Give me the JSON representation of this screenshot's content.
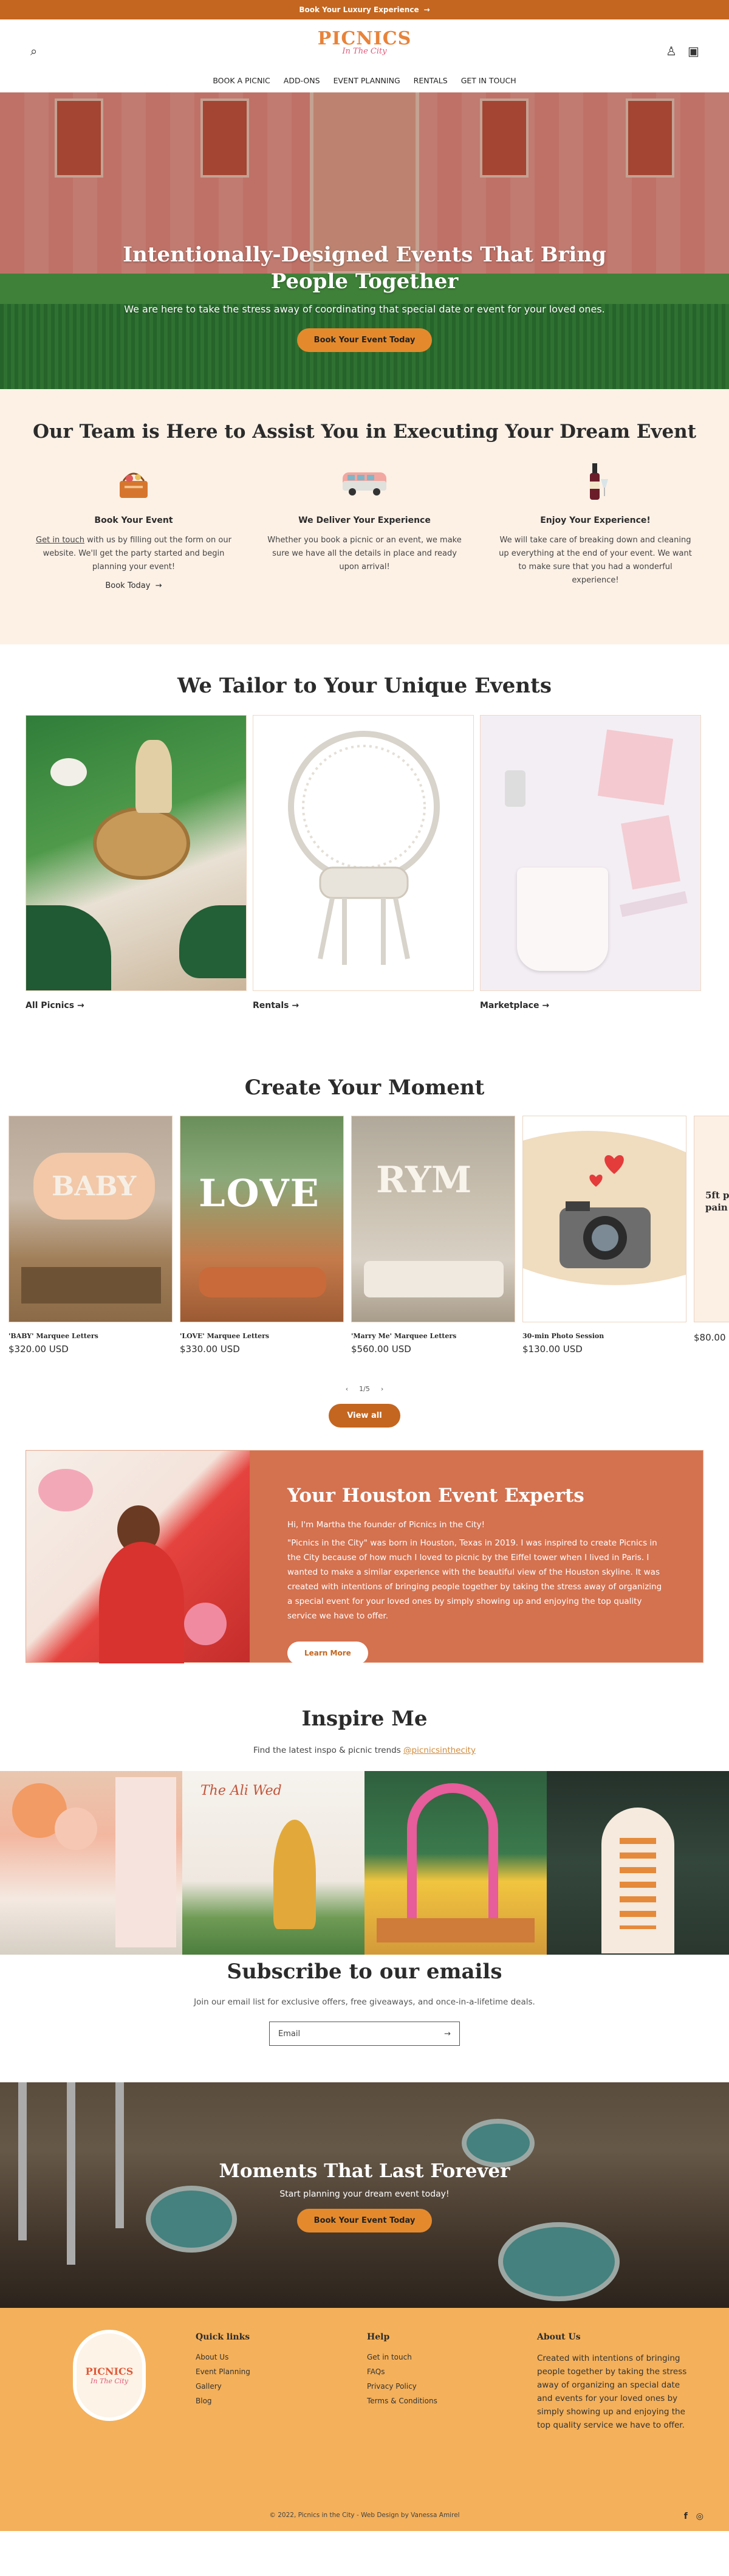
{
  "announcement": {
    "text": "Book Your Luxury Experience",
    "arrow": "→"
  },
  "header": {
    "logo_main": "PICNICS",
    "logo_sub": "In The City",
    "search_icon": "⌕",
    "account_icon": "♙",
    "cart_icon": "▣",
    "nav": [
      "BOOK A PICNIC",
      "ADD-ONS",
      "EVENT PLANNING",
      "RENTALS",
      "GET IN TOUCH"
    ]
  },
  "hero": {
    "title": "Intentionally-Designed Events That Bring People Together",
    "subtitle": "We are here to take the stress away of coordinating that special date or event for your loved ones.",
    "button": "Book Your Event Today"
  },
  "team": {
    "title": "Our Team is Here to Assist You in Executing Your Dream Event",
    "columns": [
      {
        "icon": "picnic-basket-icon",
        "heading": "Book Your Event",
        "text_link": "Get in touch",
        "text": " with us by filling out the form on our website. We'll get the party started and begin planning your event!",
        "link": "Book Today",
        "arrow": "→"
      },
      {
        "icon": "van-icon",
        "heading": "We Deliver Your Experience",
        "text": "Whether you book a picnic or an event, we make sure we have all the details in place and ready upon arrival!"
      },
      {
        "icon": "wine-icon",
        "heading": "Enjoy Your Experience!",
        "text": "We will take care of breaking down and cleaning up everything at the end of your event. We want to make sure that you had a wonderful experience!"
      }
    ]
  },
  "tailor": {
    "title": "We Tailor to Your Unique Events",
    "cards": [
      {
        "label": "All Picnics",
        "arrow": "→"
      },
      {
        "label": "Rentals",
        "arrow": "→"
      },
      {
        "label": "Marketplace",
        "arrow": "→"
      }
    ]
  },
  "moment": {
    "title": "Create Your Moment",
    "products": [
      {
        "name": "'BABY' Marquee Letters",
        "price": "$320.00 USD",
        "img_text": "BABY"
      },
      {
        "name": "'LOVE' Marquee Letters",
        "price": "$330.00 USD",
        "img_text": "LOVE"
      },
      {
        "name": "'Marry Me' Marquee Letters",
        "price": "$560.00 USD",
        "img_text": "RYM"
      },
      {
        "name": "30-min Photo Session",
        "price": "$130.00 USD",
        "img_text": ""
      },
      {
        "name": "",
        "price": "$80.00",
        "img_text": "5ft p pain"
      }
    ],
    "pager_prev": "‹",
    "pager_text": "1/5",
    "pager_next": "›",
    "button": "View all"
  },
  "houston": {
    "title": "Your Houston Event Experts",
    "intro": "Hi, I'm Martha the founder of Picnics in the City!",
    "body": "\"Picnics in the City\" was born in Houston, Texas in 2019. I was inspired to create Picnics in the City because of how much I loved to picnic by the Eiffel tower when I lived in Paris. I wanted to make a similar experience with the beautiful view of the Houston skyline. It was created with intentions of bringing people together by taking the stress away of organizing a special event for your loved ones by simply showing up and enjoying the top quality service we have to offer.",
    "button": "Learn More"
  },
  "inspire": {
    "title": "Inspire Me",
    "text": "Find the latest inspo & picnic trends ",
    "handle": "@picnicsinthecity",
    "img_text": "The Ali Wed"
  },
  "subscribe": {
    "title": "Subscribe to our emails",
    "text": "Join our email list for exclusive offers, free giveaways, and once-in-a-lifetime deals.",
    "placeholder": "Email",
    "arrow": "→"
  },
  "moments": {
    "title": "Moments That Last Forever",
    "text": "Start planning your dream event today!",
    "button": "Book Your Event Today"
  },
  "footer": {
    "logo_main": "PICNICS",
    "logo_sub": "In The City",
    "quick_links": {
      "title": "Quick links",
      "items": [
        "About Us",
        "Event Planning",
        "Gallery",
        "Blog"
      ]
    },
    "help": {
      "title": "Help",
      "items": [
        "Get in touch",
        "FAQs",
        "Privacy Policy",
        "Terms & Conditions"
      ]
    },
    "about": {
      "title": "About Us",
      "text": "Created with intentions of bringing people together by taking the stress away of organizing an special date and events for your loved ones by simply showing up and enjoying the top quality service we have to offer."
    },
    "copyright": "© 2022, Picnics in the City - Web Design by Vanessa Amirel",
    "social": [
      "f",
      "◎"
    ]
  },
  "colors": {
    "accent": "#c4661f",
    "button": "#e58a2c",
    "cream": "#fdf1e6",
    "terracotta": "#d4714f",
    "footer": "#f4b05a"
  }
}
